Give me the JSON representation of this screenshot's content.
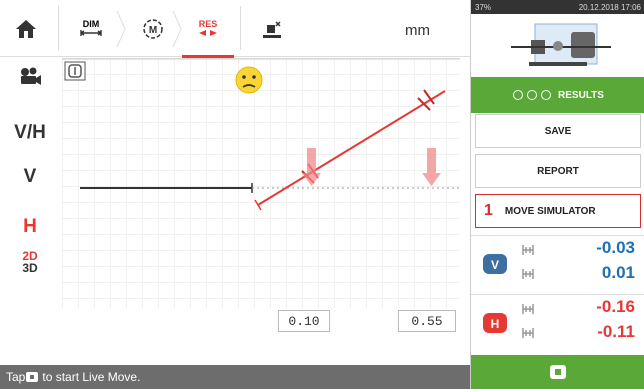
{
  "toolbar": {
    "home_icon": "home-icon",
    "dim_label": "DIM",
    "measure_label": "M",
    "res_label": "RES",
    "unit": "mm",
    "active_color": "#e53935"
  },
  "sidebar": {
    "items": [
      {
        "label": "",
        "icon": "camera-icon"
      },
      {
        "label": "V/H"
      },
      {
        "label": "V"
      },
      {
        "label": "H",
        "color": "#e53935"
      },
      {
        "label": "2D"
      },
      {
        "label": "3D"
      }
    ]
  },
  "plot": {
    "values": [
      "0.10",
      "0.55"
    ]
  },
  "status": {
    "pre": "Tap ",
    "post": "to start Live Move."
  },
  "device": {
    "battery": "37%",
    "datetime": "20.12.2018 17:06"
  },
  "right": {
    "results_label": "RESULTS",
    "save_label": "SAVE",
    "report_label": "REPORT",
    "move_num": "1",
    "move_label": "MOVE SIMULATOR",
    "v_coupling_top": "-0.03",
    "v_coupling_bottom": "0.01",
    "h_coupling_top": "-0.16",
    "h_coupling_bottom": "-0.11",
    "value_color": "#1e6fb5",
    "alert_color": "#e53935",
    "accent_green": "#5aa938"
  }
}
